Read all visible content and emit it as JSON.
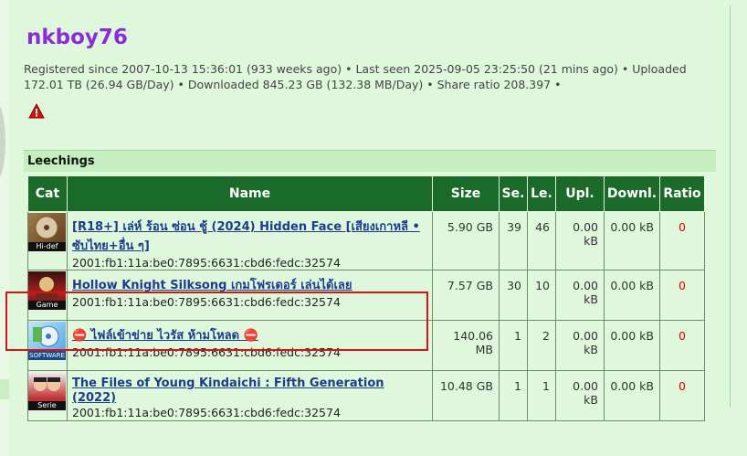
{
  "profile": {
    "username": "nkboy76",
    "info": "Registered since 2007-10-13 15:36:01 (933 weeks ago) • Last seen 2025-09-05 23:25:50 (21 mins ago) • Uploaded 172.01 TB (26.94 GB/Day) • Downloaded 845.23 GB (132.38 MB/Day) • Share ratio 208.397 •"
  },
  "leechings": {
    "title": "Leechings",
    "headers": [
      "Cat",
      "Name",
      "Size",
      "Se.",
      "Le.",
      "Upl.",
      "Downl.",
      "Ratio"
    ],
    "rows": [
      {
        "cat_label": "Hi-def",
        "cat_icon": "hidef-disc-icon",
        "name": "[R18+] เล่ห์ ร้อน ซ่อน ชู้ (2024) Hidden Face [เสียงเกาหลี • ซับไทย+อื่น ๆ]",
        "ip": "2001:fb1:11a:be0:7895:6631:cbd6:fedc:32574",
        "size": "5.90 GB",
        "seeders": "39",
        "leechers": "46",
        "upl": "0.00 kB",
        "downl": "0.00 kB",
        "ratio": "0"
      },
      {
        "cat_label": "Game",
        "cat_icon": "game-icon",
        "name": "Hollow Knight Silksong เกมโฟรเดอร์ เล่นได้เลย",
        "ip": "2001:fb1:11a:be0:7895:6631:cbd6:fedc:32574",
        "size": "7.57 GB",
        "seeders": "30",
        "leechers": "10",
        "upl": "0.00 kB",
        "downl": "0.00 kB",
        "ratio": "0"
      },
      {
        "cat_label": "SOFTWARE",
        "cat_icon": "software-cd-icon",
        "name": "⛔ ไฟล์เข้าข่าย ไวรัส ห้ามโหลด ⛔",
        "ip": "2001:fb1:11a:be0:7895:6631:cbd6:fedc:32574",
        "size": "140.06 MB",
        "seeders": "1",
        "leechers": "2",
        "upl": "0.00 kB",
        "downl": "0.00 kB",
        "ratio": "0"
      },
      {
        "cat_label": "Serie",
        "cat_icon": "serie-icon",
        "name": "The Files of Young Kindaichi : Fifth Generation (2022)",
        "ip": "2001:fb1:11a:be0:7895:6631:cbd6:fedc:32574",
        "size": "10.48 GB",
        "seeders": "1",
        "leechers": "1",
        "upl": "0.00 kB",
        "downl": "0.00 kB",
        "ratio": "0"
      }
    ]
  },
  "colors": {
    "accent": "#8a2be2",
    "header": "#1a6b2a",
    "link": "#1a3d8f",
    "ratio": "#e00000",
    "highlight": "#dd1111"
  }
}
